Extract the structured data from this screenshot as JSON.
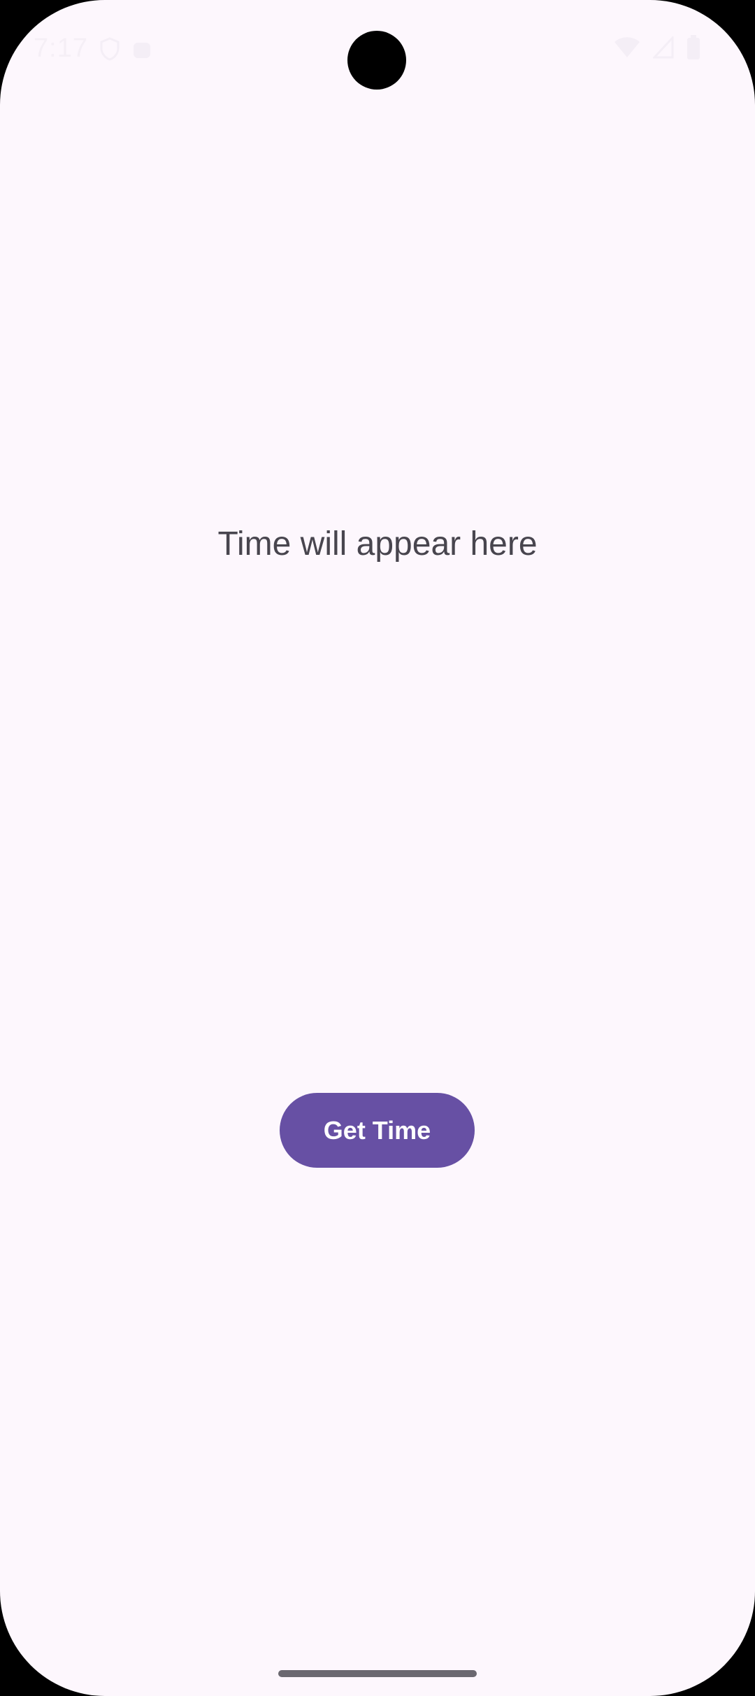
{
  "status_bar": {
    "time": "7:17",
    "left_icons": [
      "vpn-shield-icon",
      "android-head-icon"
    ],
    "right_icons": [
      "wifi-icon",
      "signal-icon",
      "battery-icon"
    ]
  },
  "main": {
    "time_display": "Time will appear here",
    "get_time_label": "Get Time"
  },
  "colors": {
    "background": "#FDF7FD",
    "button": "#6750A4",
    "text": "#48454E"
  }
}
